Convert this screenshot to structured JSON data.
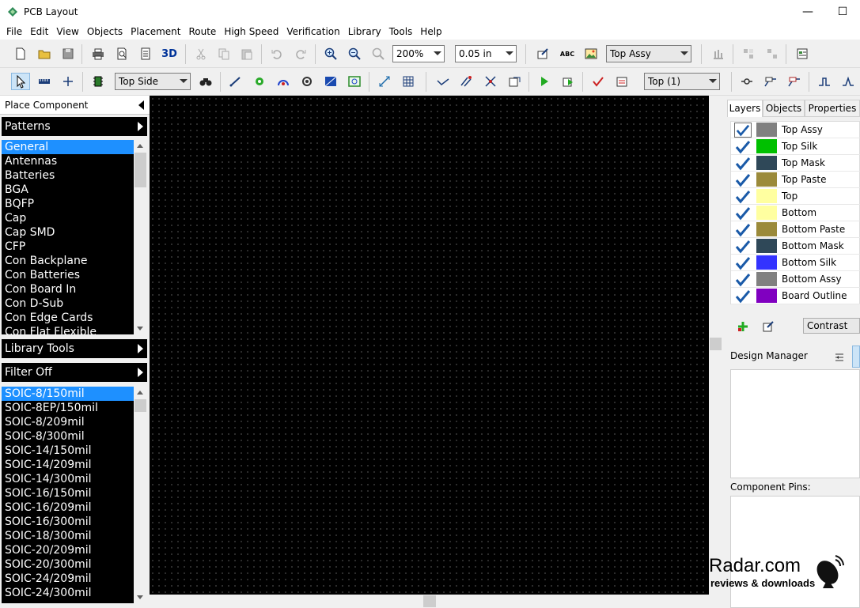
{
  "window": {
    "title": "PCB Layout"
  },
  "menu": [
    "File",
    "Edit",
    "View",
    "Objects",
    "Placement",
    "Route",
    "High Speed",
    "Verification",
    "Library",
    "Tools",
    "Help"
  ],
  "toolbar1": {
    "three_d_label": "3D",
    "zoom_value": "200%",
    "grid_value": "0.05 in",
    "abc_label": "ABC",
    "layer_select": "Top Assy"
  },
  "toolbar2": {
    "side_select": "Top Side",
    "layer_select": "Top (1)"
  },
  "left_panel": {
    "place_component_label": "Place Component",
    "patterns_label": "Patterns",
    "patterns": [
      "General",
      "Antennas",
      "Batteries",
      "BGA",
      "BQFP",
      "Cap",
      "Cap SMD",
      "CFP",
      "Con Backplane",
      "Con Batteries",
      "Con Board In",
      "Con D-Sub",
      "Con Edge Cards",
      "Con Flat Flexible"
    ],
    "library_tools_label": "Library Tools",
    "filter_label": "Filter Off",
    "components": [
      "SOIC-8/150mil",
      "SOIC-8EP/150mil",
      "SOIC-8/209mil",
      "SOIC-8/300mil",
      "SOIC-14/150mil",
      "SOIC-14/209mil",
      "SOIC-14/300mil",
      "SOIC-16/150mil",
      "SOIC-16/209mil",
      "SOIC-16/300mil",
      "SOIC-18/300mil",
      "SOIC-20/209mil",
      "SOIC-20/300mil",
      "SOIC-24/209mil",
      "SOIC-24/300mil"
    ]
  },
  "right_panel": {
    "tabs": [
      "Layers",
      "Objects",
      "Properties"
    ],
    "layers": [
      {
        "name": "Top Assy",
        "color": "#808080"
      },
      {
        "name": "Top Silk",
        "color": "#00c000"
      },
      {
        "name": "Top Mask",
        "color": "#2f4858"
      },
      {
        "name": "Top Paste",
        "color": "#9b8a3a"
      },
      {
        "name": "Top",
        "color": "#ffffa0"
      },
      {
        "name": "Bottom",
        "color": "#ffffa0"
      },
      {
        "name": "Bottom Paste",
        "color": "#9b8a3a"
      },
      {
        "name": "Bottom Mask",
        "color": "#2f4858"
      },
      {
        "name": "Bottom Silk",
        "color": "#3333ff"
      },
      {
        "name": "Bottom Assy",
        "color": "#808080"
      },
      {
        "name": "Board Outline",
        "color": "#8000c0"
      }
    ],
    "contrast_label": "Contrast",
    "design_manager_label": "Design Manager",
    "component_pins_label": "Component Pins:"
  },
  "watermark": {
    "text": "Radar.com",
    "subtext": "reviews & downloads"
  }
}
